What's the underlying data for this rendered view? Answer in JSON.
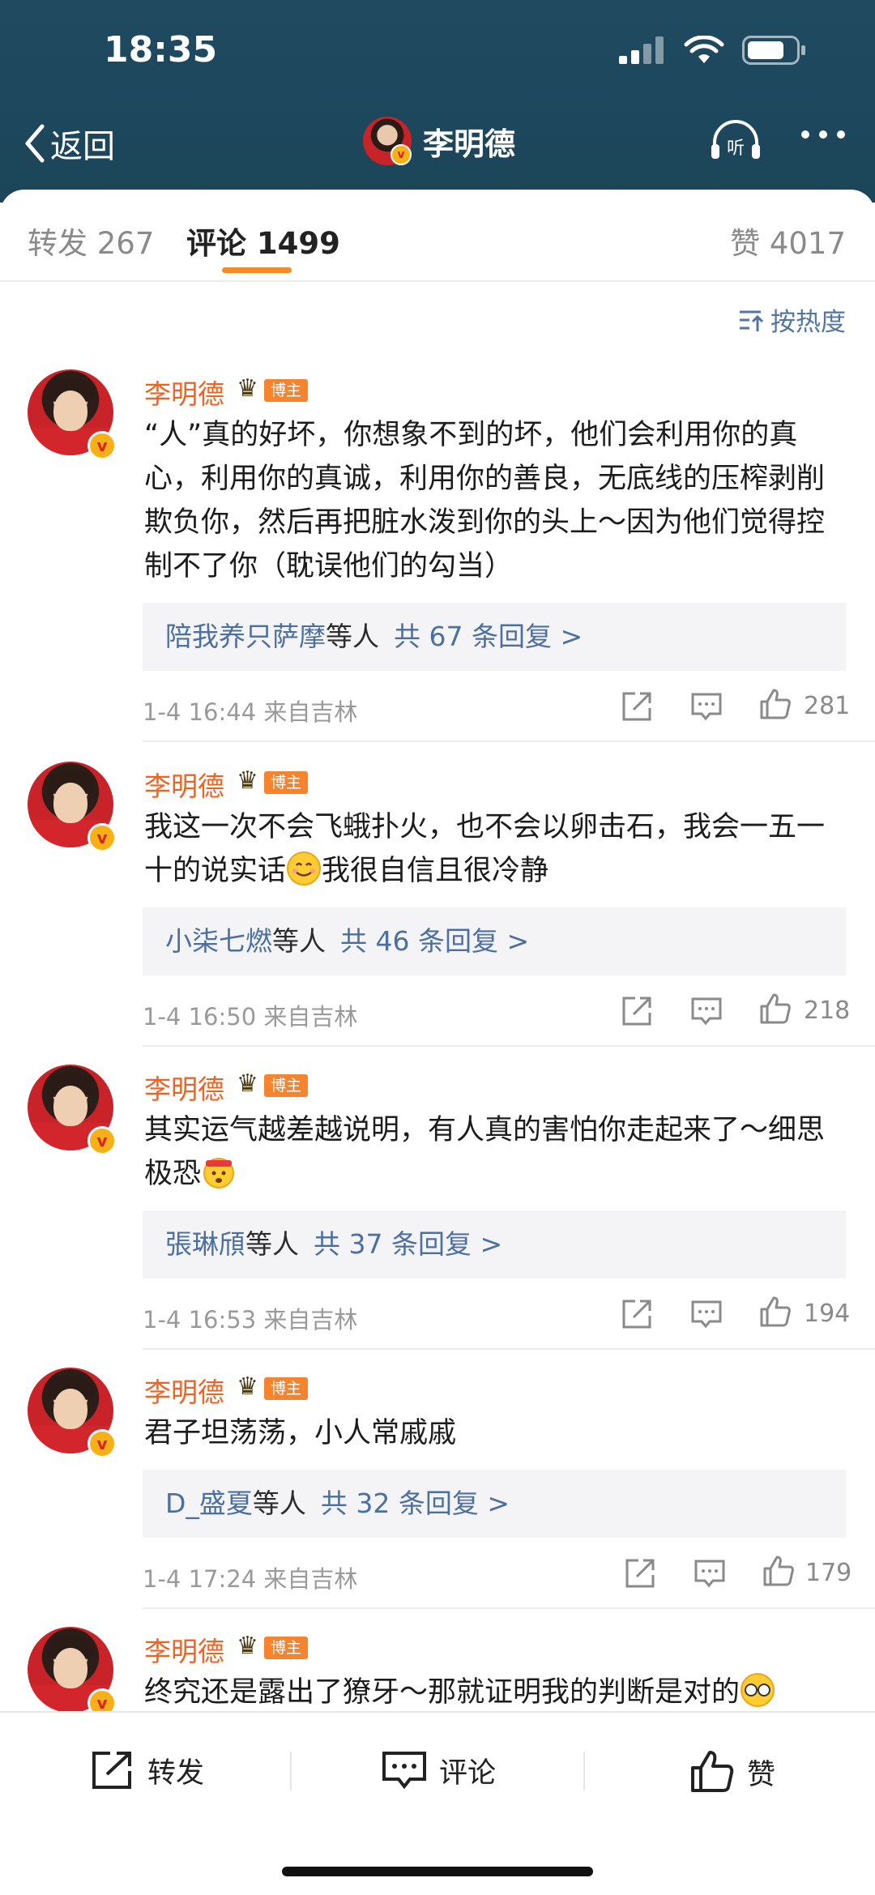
{
  "status": {
    "time": "18:35"
  },
  "nav": {
    "back_label": "返回",
    "title": "李明德"
  },
  "tabs": {
    "repost": "转发 267",
    "comments": "评论 1499",
    "likes": "赞 4017"
  },
  "sort": {
    "label": "按热度"
  },
  "badge": {
    "bozhu": "博主"
  },
  "comments": [
    {
      "author": "李明德",
      "text": "“人”真的好坏，你想象不到的坏，他们会利用你的真心，利用你的真诚，利用你的善良，无底线的压榨剥削欺负你，然后再把脏水泼到你的头上～因为他们觉得控制不了你（耽误他们的勾当）",
      "reply_name": "陪我养只萨摩",
      "reply_mid": "等人",
      "reply_count": "共 67 条回复 >",
      "meta": "1-4 16:44  来自吉林",
      "likes": "281"
    },
    {
      "author": "李明德",
      "text": "我这一次不会飞蛾扑火，也不会以卵击石，我会一五一十的说实话",
      "text_after": "我很自信且很冷静",
      "reply_name": "小柒七燃",
      "reply_mid": "等人",
      "reply_count": "共 46 条回复 >",
      "meta": "1-4 16:50  来自吉林",
      "likes": "218"
    },
    {
      "author": "李明德",
      "text": "其实运气越差越说明，有人真的害怕你走起来了～细思极恐",
      "reply_name": "張琳頎",
      "reply_mid": "等人",
      "reply_count": "共 37 条回复 >",
      "meta": "1-4 16:53  来自吉林",
      "likes": "194"
    },
    {
      "author": "李明德",
      "text": "君子坦荡荡，小人常戚戚",
      "reply_name": "D_盛夏",
      "reply_mid": "等人",
      "reply_count": "共 32 条回复 >",
      "meta": "1-4 17:24  来自吉林",
      "likes": "179"
    },
    {
      "author": "李明德",
      "text": "终究还是露出了獠牙～那就证明我的判断是对的"
    }
  ],
  "bottom": {
    "repost": "转发",
    "comment": "评论",
    "like": "赞"
  },
  "colors": {
    "header_bg": "#1f4a60",
    "accent": "#f28b28",
    "username": "#f0621f",
    "link": "#4c6fa2"
  }
}
